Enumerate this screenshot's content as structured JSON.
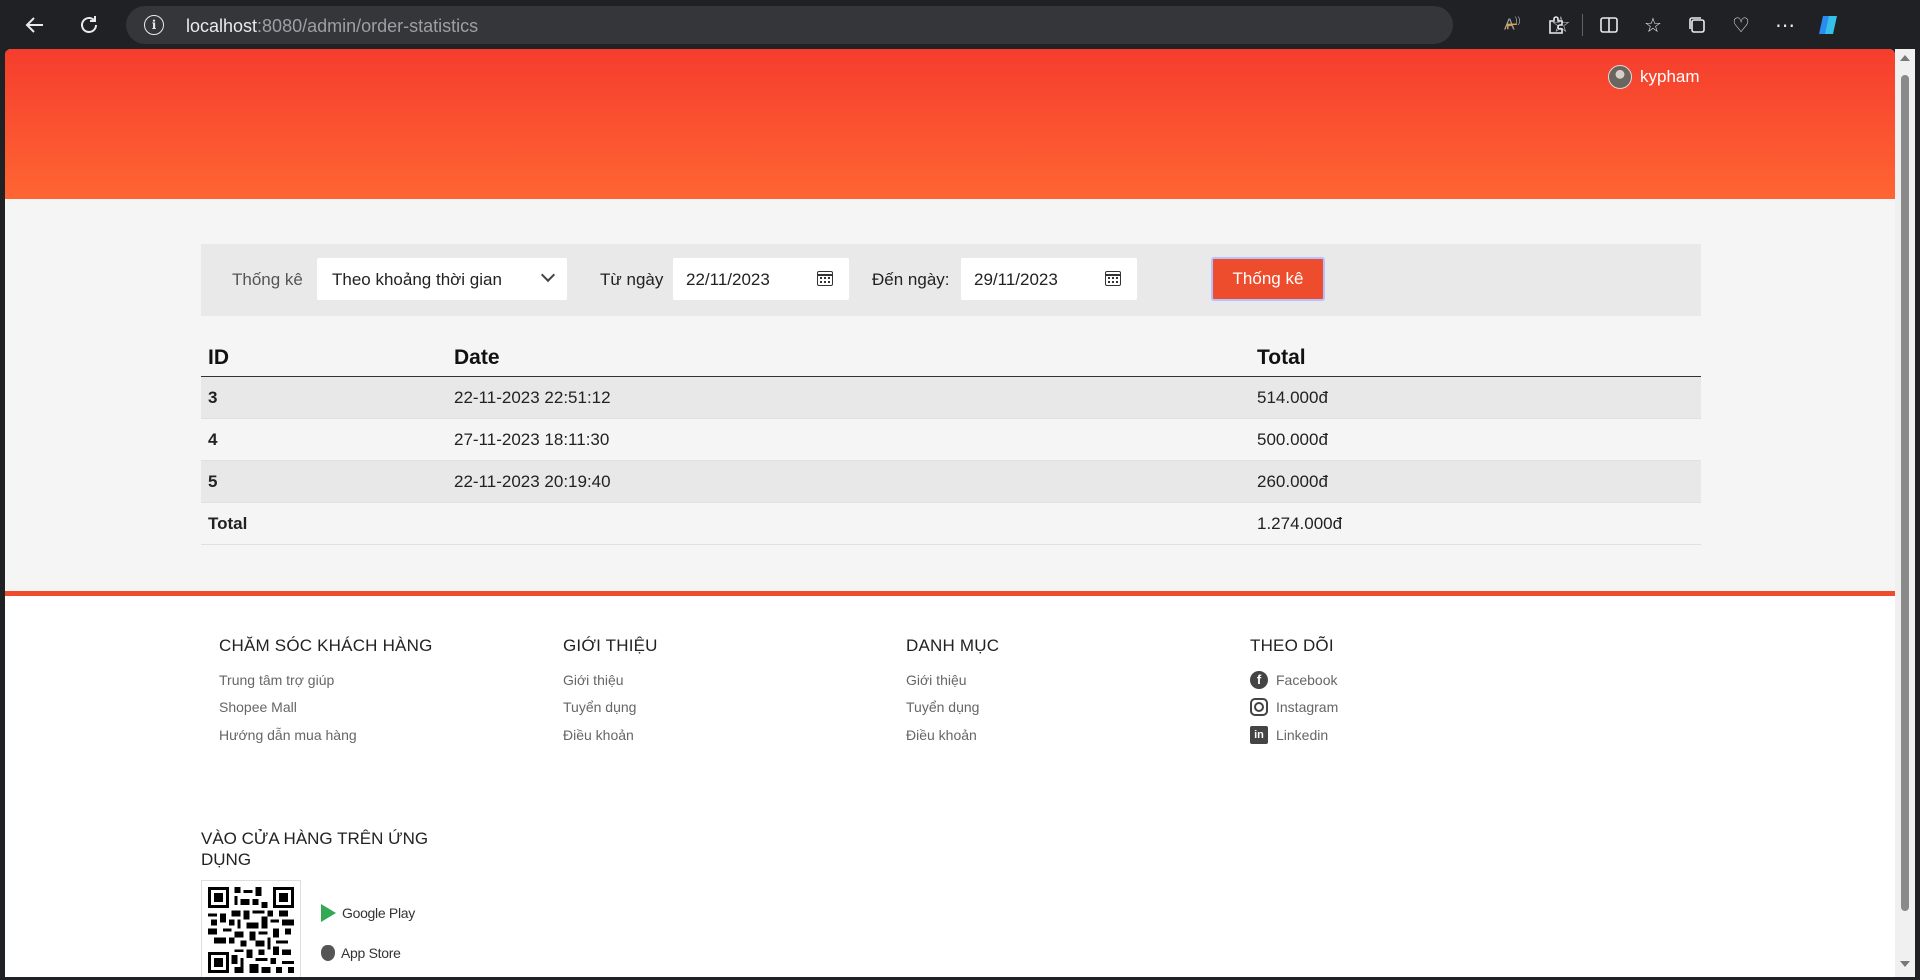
{
  "browser": {
    "url_host": "localhost",
    "url_path": ":8080/admin/order-statistics",
    "icons": [
      "back-arrow-icon",
      "reload-icon",
      "info-icon",
      "read-aloud-icon",
      "favorite-star-icon",
      "extension-icon",
      "puzzle-icon",
      "split-screen-icon",
      "favorites-icon",
      "collections-icon",
      "health-icon",
      "more-icon",
      "copilot-icon"
    ]
  },
  "header": {
    "username": "kypham",
    "gradient_top": "#f53d2d",
    "gradient_bottom": "#ff6533"
  },
  "filter": {
    "stat_label": "Thống kê",
    "mode_value": "Theo khoảng thời gian",
    "from_label": "Từ ngày",
    "from_value": "22/11/2023",
    "to_label": "Đến ngày:",
    "to_value": "29/11/2023",
    "submit_label": "Thống kê"
  },
  "table": {
    "headers": {
      "id": "ID",
      "date": "Date",
      "total": "Total"
    },
    "rows": [
      {
        "id": "3",
        "date": "22-11-2023 22:51:12",
        "total": "514.000đ"
      },
      {
        "id": "4",
        "date": "27-11-2023 18:11:30",
        "total": "500.000đ"
      },
      {
        "id": "5",
        "date": "22-11-2023 20:19:40",
        "total": "260.000đ"
      }
    ],
    "total_label": "Total",
    "total_value": "1.274.000đ"
  },
  "footer": {
    "accent": "#ee4d2d",
    "cols": [
      {
        "title": "CHĂM SÓC KHÁCH HÀNG",
        "links": [
          "Trung tâm trợ giúp",
          "Shopee Mall",
          "Hướng dẫn mua hàng"
        ]
      },
      {
        "title": "GIỚI THIỆU",
        "links": [
          "Giới thiệu",
          "Tuyển dụng",
          "Điều khoản"
        ]
      },
      {
        "title": "DANH MỤC",
        "links": [
          "Giới thiệu",
          "Tuyển dụng",
          "Điều khoản"
        ]
      },
      {
        "title": "THEO DÕI",
        "links": [
          "Facebook",
          "Instagram",
          "Linkedin"
        ]
      }
    ],
    "app_title": "VÀO CỬA HÀNG TRÊN ỨNG DỤNG",
    "google_play": "Google Play",
    "app_store": "App Store"
  }
}
